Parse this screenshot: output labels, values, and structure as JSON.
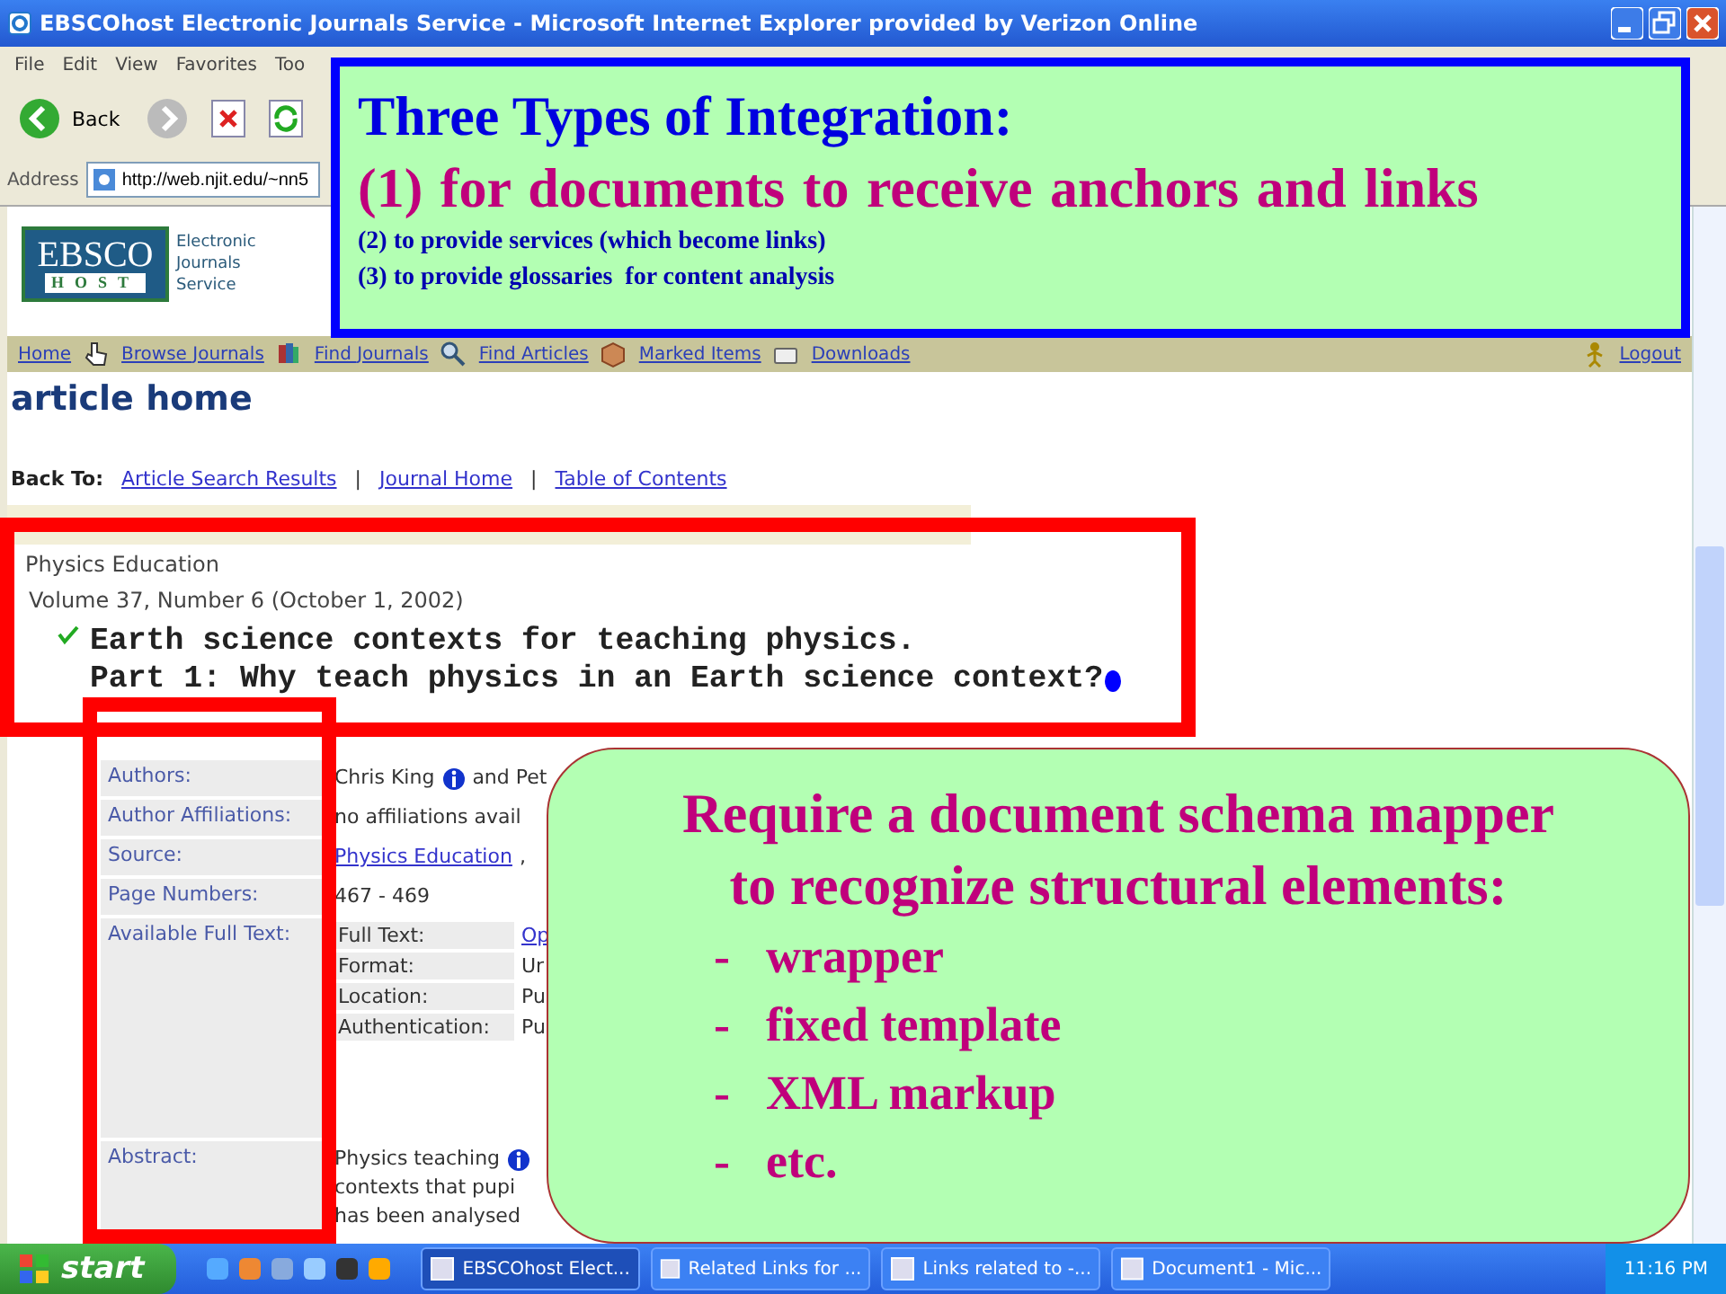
{
  "window": {
    "title": "EBSCOhost Electronic Journals Service - Microsoft Internet Explorer provided by Verizon Online"
  },
  "menu": [
    "File",
    "Edit",
    "View",
    "Favorites",
    "Too"
  ],
  "toolbar": {
    "back_label": "Back"
  },
  "address": {
    "label": "Address",
    "value": "http://web.njit.edu/~nn5"
  },
  "site": {
    "logo_top": "EBSCO",
    "logo_bottom": "HOST",
    "tagline": [
      "Electronic",
      "Journals",
      "Service"
    ]
  },
  "nav": [
    {
      "label": "Home"
    },
    {
      "label": "Browse Journals"
    },
    {
      "label": "Find Journals"
    },
    {
      "label": "Find Articles"
    },
    {
      "label": "Marked Items"
    },
    {
      "label": "Downloads"
    }
  ],
  "logout": {
    "label": "Logout"
  },
  "page": {
    "heading": "article home",
    "back_label": "Back To:",
    "back_links": [
      {
        "label": "Article Search Results"
      },
      {
        "separator": "|",
        "label": "Journal Home"
      },
      {
        "separator": "|",
        "label": "Table of Contents"
      }
    ],
    "journal": "Physics Education",
    "issue": "Volume 37, Number 6 (October 1, 2002)",
    "title_lines": [
      "Earth science contexts for teaching physics.",
      "Part 1: Why teach physics in an Earth science context?"
    ]
  },
  "details": [
    {
      "label": "Authors:",
      "kind": "text",
      "lines": [
        "Chris King"
      ],
      "info": true,
      "extra": "and Pet"
    },
    {
      "label": "Author Affiliations:",
      "kind": "text",
      "lines": [
        "no affiliations avail"
      ],
      "info": false
    },
    {
      "label": "Source:",
      "kind": "link",
      "lines": [
        "Physics Education"
      ],
      "info": false,
      "extra": ","
    },
    {
      "label": "Page Numbers:",
      "kind": "text",
      "lines": [
        "467 - 469"
      ],
      "info": false
    },
    {
      "label": "Available Full Text:",
      "kind": "table",
      "rows": [
        {
          "label": "Full Text:",
          "value": "Op",
          "link": true
        },
        {
          "label": "Format:",
          "value": "Ur",
          "link": false
        },
        {
          "label": "Location:",
          "value": "Pu",
          "link": false
        },
        {
          "label": "Authentication:",
          "value": "Pu",
          "link": false
        }
      ]
    },
    {
      "label": "Abstract:",
      "kind": "text",
      "lines": [
        "Physics teaching",
        "contexts that pupi",
        "has been analysed"
      ],
      "info": true
    }
  ],
  "taskbar": {
    "start": "start",
    "tasks": [
      {
        "label": "EBSCOhost Elect...",
        "selected": true
      },
      {
        "label": "Related Links for ...",
        "selected": false
      },
      {
        "label": "Links related to -...",
        "selected": false
      },
      {
        "label": "Document1 - Mic...",
        "selected": false
      }
    ],
    "clock": "11:16 PM"
  },
  "callouts": {
    "integration": {
      "title": "Three Types of Integration:",
      "lead": "(1) for documents to receive anchors and links",
      "items": [
        "(2) to provide services (which become links)",
        "(3) to provide glossaries  for content analysis"
      ]
    },
    "schema": {
      "lines": [
        "Require a document schema mapper",
        "to recognize structural elements:"
      ],
      "items": [
        {
          "bullet": "-",
          "text": "wrapper"
        },
        {
          "bullet": "-",
          "text": "fixed template"
        },
        {
          "bullet": "-",
          "text": "XML markup"
        },
        {
          "bullet": "-",
          "text": "etc."
        }
      ]
    }
  }
}
